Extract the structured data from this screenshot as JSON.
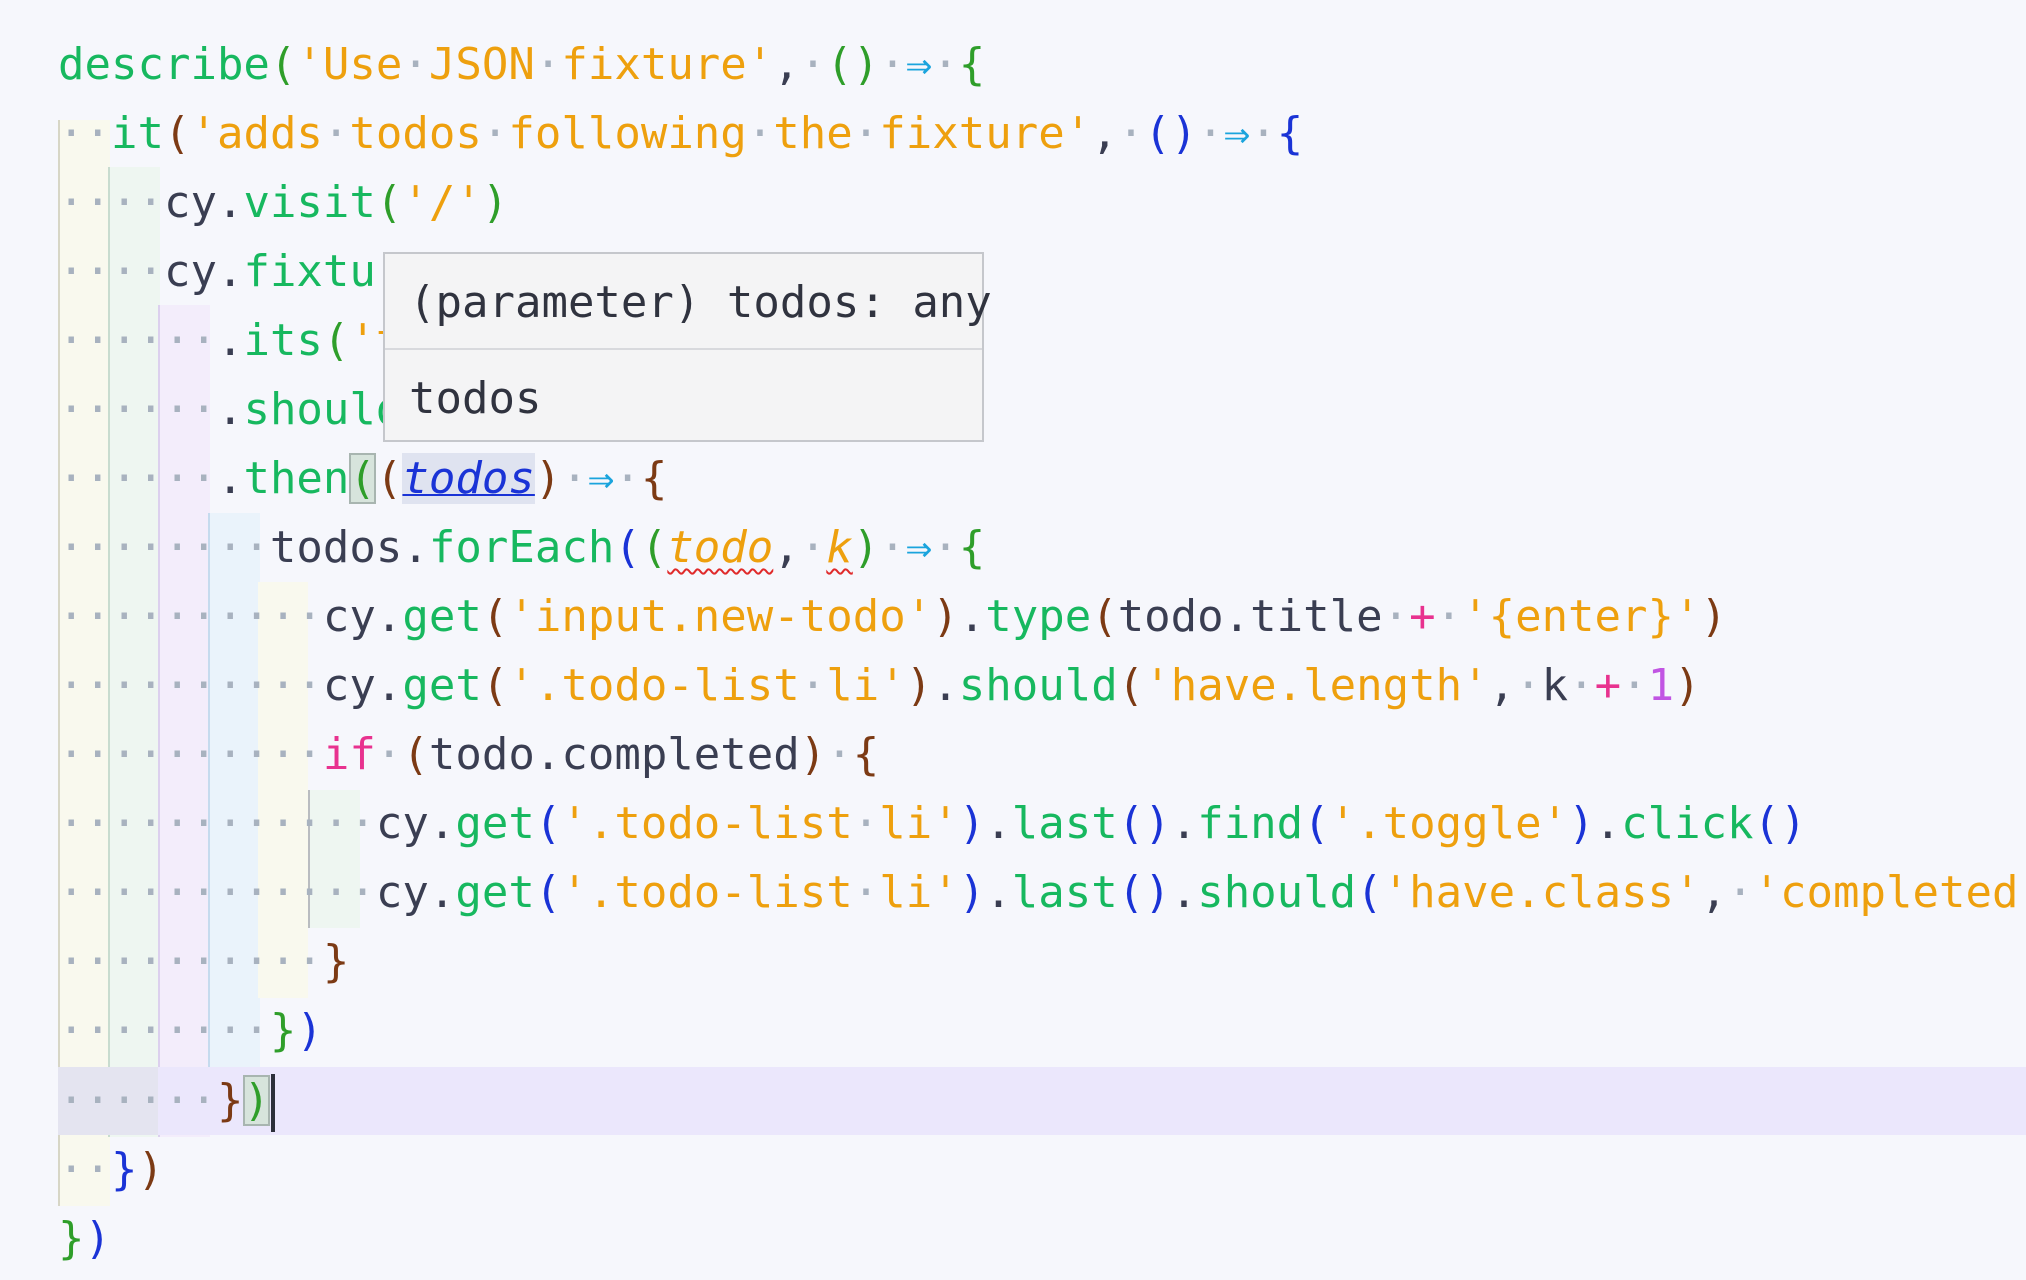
{
  "editor": {
    "language": "javascript",
    "theme_colors": {
      "background": "#f6f7fc",
      "current_line": "#ebe7fc",
      "function": "#17b85f",
      "string": "#eea00e",
      "keyword": "#e8328f",
      "number": "#c155e3",
      "arrow": "#1aa4dd",
      "bracket_level_1": "#2f9e2a",
      "bracket_level_2": "#1a33d6",
      "bracket_level_3": "#7c3a14"
    },
    "cursor_line": 15,
    "hover_target": "todos",
    "lines": [
      "describe('Use JSON fixture', () => {",
      "  it('adds todos following the fixture', () => {",
      "    cy.visit('/')",
      "    cy.fixtur",
      "      .its('t",
      "      .should",
      "      .then((todos) => {",
      "        todos.forEach((todo, k) => {",
      "          cy.get('input.new-todo').type(todo.title + '{enter}')",
      "          cy.get('.todo-list li').should('have.length', k + 1)",
      "          if (todo.completed) {",
      "            cy.get('.todo-list li').last().find('.toggle').click()",
      "            cy.get('.todo-list li').last().should('have.class', 'completed')",
      "          }",
      "        })",
      "      })",
      "  })",
      "})"
    ]
  },
  "hover_tooltip": {
    "signature": "(parameter) todos: any",
    "documentation": "todos"
  }
}
